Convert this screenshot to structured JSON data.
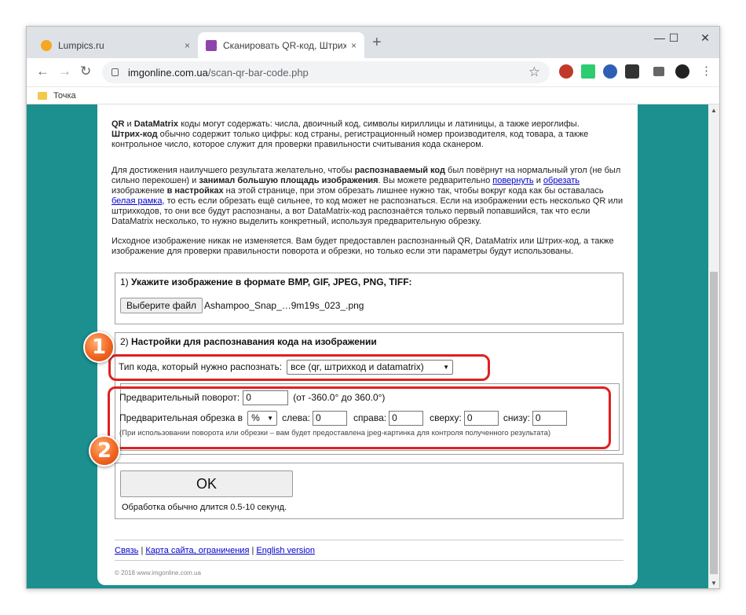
{
  "browser": {
    "tabs": [
      {
        "title": "Lumpics.ru",
        "close": "×"
      },
      {
        "title": "Сканировать QR-код, Штрих-ко",
        "close": "×"
      }
    ],
    "new_tab": "+",
    "window_controls": {
      "minimize": "—",
      "maximize": "☐",
      "close": "✕"
    },
    "url_host": "imgonline.com.ua",
    "url_path": "/scan-qr-bar-code.php",
    "bookmark": "Точка",
    "icons": [
      "back-icon",
      "forward-icon",
      "reload-icon",
      "lock-icon",
      "star-icon",
      "menu-icon"
    ]
  },
  "page": {
    "intro": {
      "b1": "QR",
      "t1": " и ",
      "b2": "DataMatrix",
      "t2": " коды могут содержать: числа, двоичный код, символы кириллицы и латиницы, а также иероглифы.",
      "b3": "Штрих-код",
      "t3": " обычно содержит только цифры: код страны, регистрационный номер производителя, код товара, а также контрольное число, которое служит для проверки правильности считывания кода сканером."
    },
    "advice": {
      "t1": "Для достижения наилучшего результата желательно, чтобы ",
      "b1": "распознаваемый код",
      "t2": " был повёрнут на нормальный угол (не был сильно перекошен) и ",
      "b2": "занимал большую площадь изображения",
      "t3": ". Вы можете редварительно ",
      "l1": "повернуть",
      "t4": " и ",
      "l2": "обрезать",
      "t5": " изображение ",
      "b3": "в настройках",
      "t6": " на этой странице, при этом обрезать лишнее нужно так, чтобы вокруг кода как бы оставалась ",
      "l3": "белая рамка",
      "t7": ", то есть если обрезать ещё сильнее, то код может не распознаться. Если на изображении есть несколько QR или штрихкодов, то они все будут распознаны, а вот DataMatrix-код распознаётся только первый попавшийся, так что если DataMatrix несколько, то нужно выделить конкретный, используя предварительную обрезку."
    },
    "source_note": "Исходное изображение никак не изменяется. Вам будет предоставлен распознанный QR, DataMatrix или Штрих-код, а также изображение для проверки правильности поворота и обрезки, но только если эти параметры будут использованы.",
    "step1": {
      "title_prefix": "1) ",
      "title": "Укажите изображение в формате BMP, GIF, JPEG, PNG, TIFF:",
      "button": "Выберите файл",
      "filename": "Ashampoo_Snap_…9m19s_023_.png"
    },
    "step2": {
      "title_prefix": "2) ",
      "title": "Настройки для распознавания кода на изображении",
      "code_type_label": "Тип кода, который нужно распознать:",
      "code_type_value": "все (qr, штрихкод и datamatrix)",
      "rotate_label": "Предварительный поворот:",
      "rotate_value": "0",
      "rotate_hint": "(от -360.0° до 360.0°)",
      "crop_label": "Предварительная обрезка в",
      "crop_unit": "%",
      "left_label": "слева:",
      "left_value": "0",
      "right_label": "справа:",
      "right_value": "0",
      "top_label": "сверху:",
      "top_value": "0",
      "bottom_label": "снизу:",
      "bottom_value": "0",
      "note": "(При использовании поворота или обрезки – вам будет предоставлена jpeg-картинка для контроля полученного результата)"
    },
    "submit": {
      "button": "OK",
      "note": "Обработка обычно длится 0.5-10 секунд."
    },
    "footer": {
      "links": [
        "Связь",
        "Карта сайта, ограничения",
        "English version"
      ],
      "sep": " | ",
      "copyright": "© 2018 www.imgonline.com.ua"
    }
  },
  "annotations": {
    "badge1": "1",
    "badge2": "2",
    "highlight_color": "#e02020",
    "badge_color": "#f26522"
  }
}
